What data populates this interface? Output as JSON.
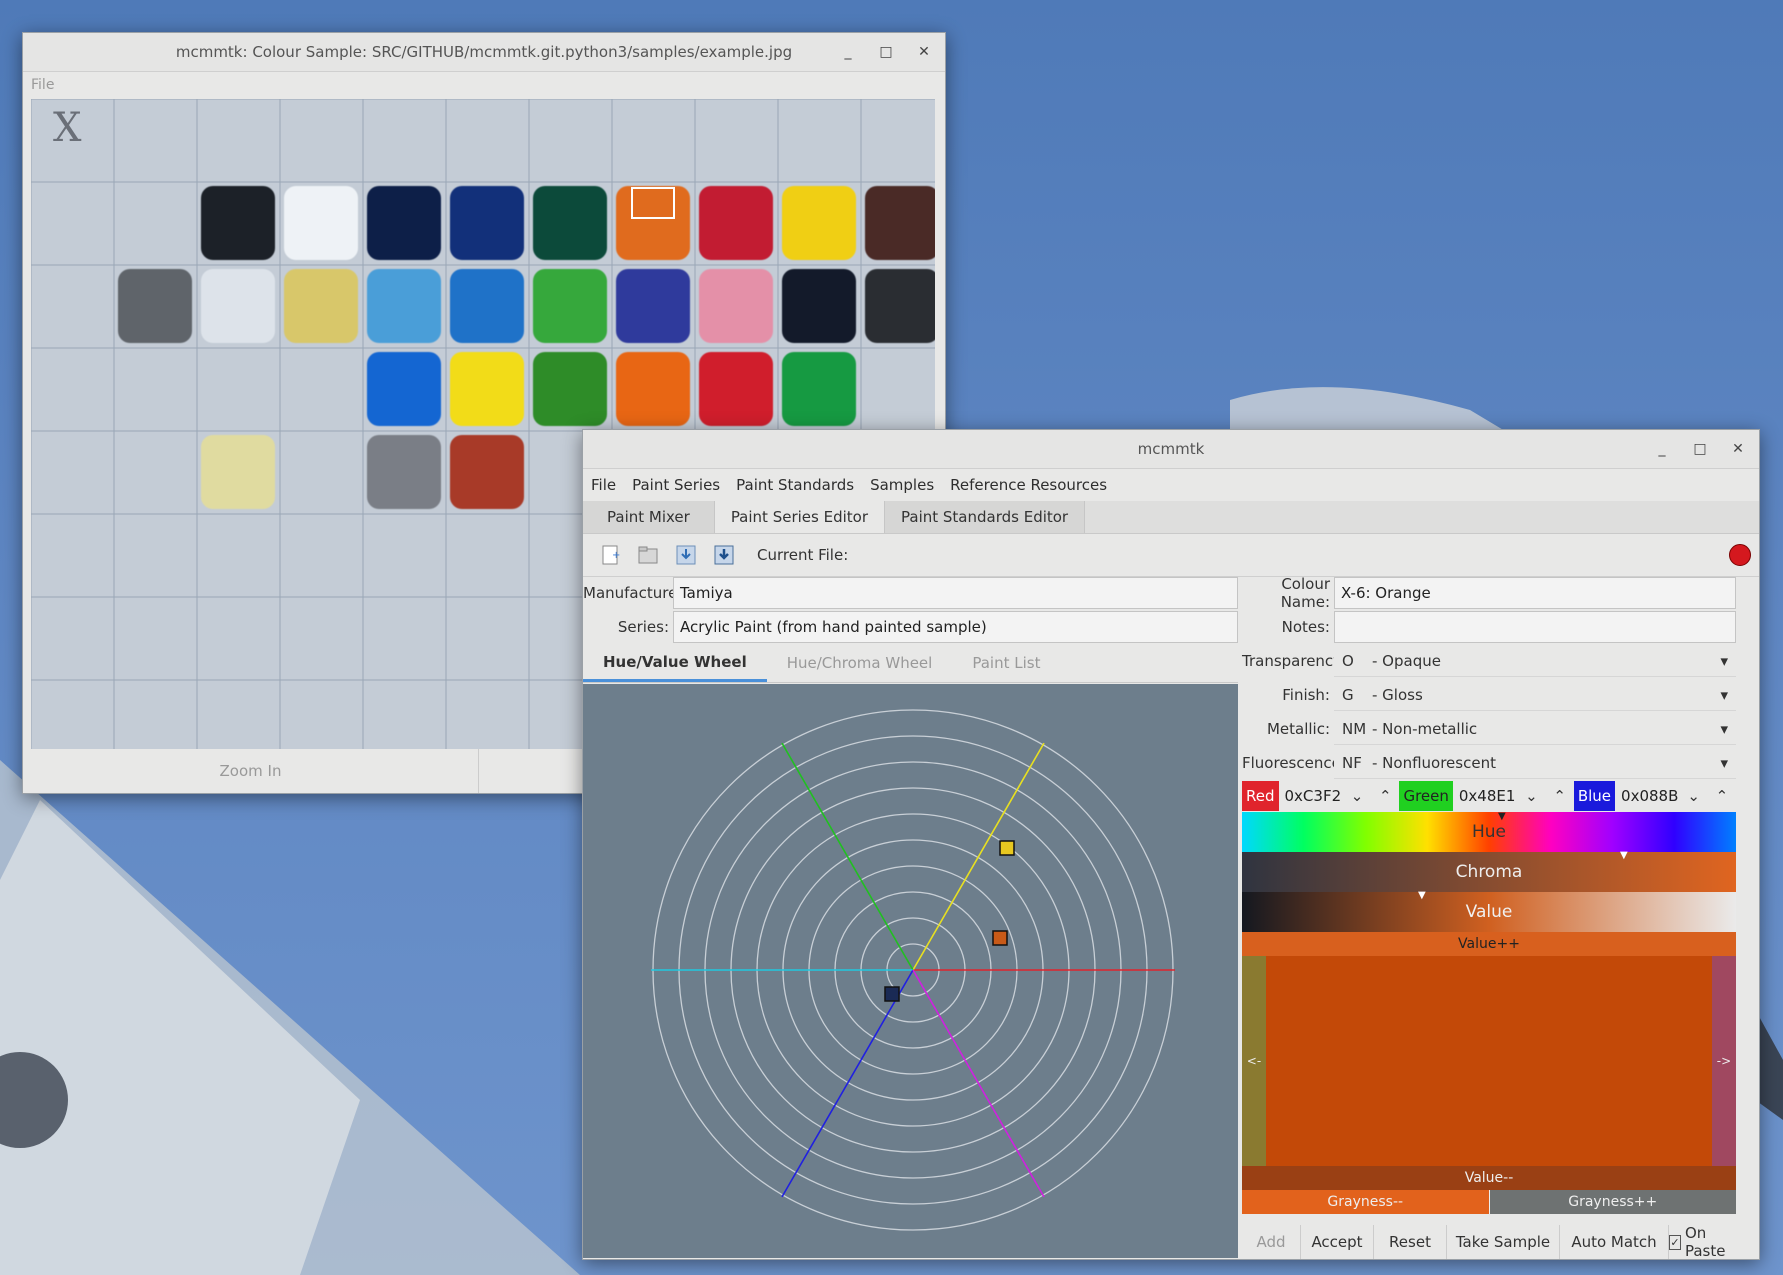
{
  "sample_window": {
    "title": "mcmmtk: Colour Sample: SRC/GITHUB/mcmmtk.git.python3/samples/example.jpg",
    "menu_file": "File",
    "zoom_in": "Zoom In",
    "swatches": [
      {
        "col": 1,
        "row": 0,
        "color": "#1c2128"
      },
      {
        "col": 2,
        "row": 0,
        "color": "#eef2f6"
      },
      {
        "col": 3,
        "row": 0,
        "color": "#0d1f48"
      },
      {
        "col": 4,
        "row": 0,
        "color": "#12307a"
      },
      {
        "col": 5,
        "row": 0,
        "color": "#0c4a3a"
      },
      {
        "col": 6,
        "row": 0,
        "color": "#e06b1e"
      },
      {
        "col": 7,
        "row": 0,
        "color": "#c21c32"
      },
      {
        "col": 8,
        "row": 0,
        "color": "#f0cf14"
      },
      {
        "col": 9,
        "row": 0,
        "color": "#4a2a26"
      },
      {
        "col": 0,
        "row": 1,
        "color": "#5f646a"
      },
      {
        "col": 1,
        "row": 1,
        "color": "#dde3ea"
      },
      {
        "col": 2,
        "row": 1,
        "color": "#d8c76a"
      },
      {
        "col": 3,
        "row": 1,
        "color": "#4a9ed8"
      },
      {
        "col": 4,
        "row": 1,
        "color": "#1f72c8"
      },
      {
        "col": 5,
        "row": 1,
        "color": "#36a83c"
      },
      {
        "col": 6,
        "row": 1,
        "color": "#2f3a9c"
      },
      {
        "col": 7,
        "row": 1,
        "color": "#e490a8"
      },
      {
        "col": 8,
        "row": 1,
        "color": "#131a2a"
      },
      {
        "col": 9,
        "row": 1,
        "color": "#2a2d32"
      },
      {
        "col": 3,
        "row": 2,
        "color": "#1466d2"
      },
      {
        "col": 4,
        "row": 2,
        "color": "#f2dc18"
      },
      {
        "col": 5,
        "row": 2,
        "color": "#2e8c28"
      },
      {
        "col": 6,
        "row": 2,
        "color": "#e86614"
      },
      {
        "col": 7,
        "row": 2,
        "color": "#d01e2c"
      },
      {
        "col": 8,
        "row": 2,
        "color": "#169a42"
      },
      {
        "col": 1,
        "row": 3,
        "color": "#e0dba0"
      },
      {
        "col": 3,
        "row": 3,
        "color": "#7a7e86"
      },
      {
        "col": 4,
        "row": 3,
        "color": "#a83a28"
      }
    ]
  },
  "main_window": {
    "title": "mcmmtk",
    "menu": [
      "File",
      "Paint Series",
      "Paint Standards",
      "Samples",
      "Reference Resources"
    ],
    "tabs": [
      "Paint Mixer",
      "Paint Series Editor",
      "Paint Standards Editor"
    ],
    "current_file_label": "Current File:",
    "manufacturer_label": "Manufacturer:",
    "manufacturer_value": "Tamiya",
    "series_label": "Series:",
    "series_value": "Acrylic Paint (from hand painted sample)",
    "subtabs": [
      "Hue/Value Wheel",
      "Hue/Chroma Wheel",
      "Paint List"
    ],
    "colour_name_label": "Colour Name:",
    "colour_name_value": "X-6: Orange",
    "notes_label": "Notes:",
    "notes_value": "",
    "transparency_label": "Transparency:",
    "transparency_code": "O",
    "transparency_value": "- Opaque",
    "finish_label": "Finish:",
    "finish_code": "G",
    "finish_value": "- Gloss",
    "metallic_label": "Metallic:",
    "metallic_code": "NM",
    "metallic_value": "- Non-metallic",
    "fluorescence_label": "Fluorescence:",
    "fluorescence_code": "NF",
    "fluorescence_value": "- Nonfluorescent",
    "red_label": "Red",
    "red_value": "0xC3F2",
    "green_label": "Green",
    "green_value": "0x48E1",
    "blue_label": "Blue",
    "blue_value": "0x088B",
    "hue_label": "Hue",
    "chroma_label": "Chroma",
    "value_label": "Value",
    "value_plus": "Value++",
    "value_minus": "Value--",
    "left_arrow": "<-",
    "right_arrow": "->",
    "grayness_minus": "Grayness--",
    "grayness_plus": "Grayness++",
    "buttons": {
      "add": "Add",
      "accept": "Accept",
      "reset": "Reset",
      "take_sample": "Take Sample",
      "auto_match": "Auto Match",
      "on_paste": "On Paste"
    },
    "colors": {
      "sample": "#c34908",
      "red": "#e0242c",
      "green": "#20d020",
      "blue": "#1a1adc"
    }
  }
}
